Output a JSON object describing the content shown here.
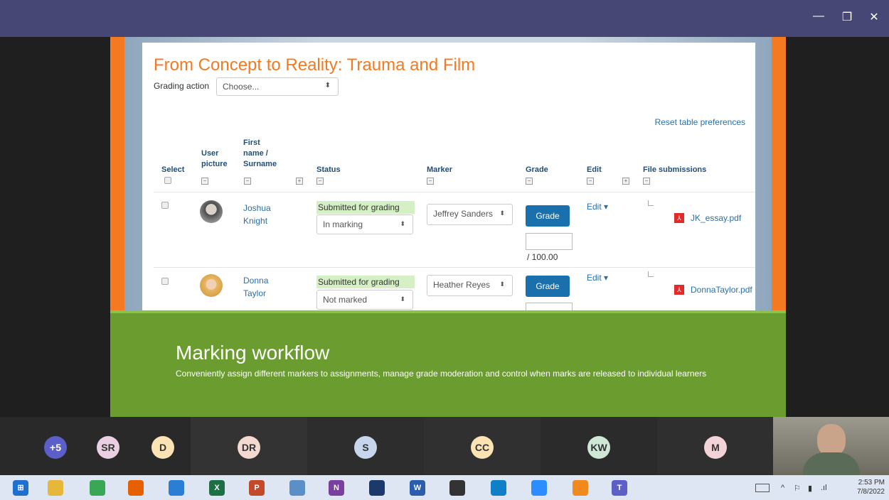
{
  "window": {
    "minimize": "—",
    "restore": "❐",
    "close": "✕"
  },
  "moodle": {
    "title": "From Concept to Reality: Trauma and Film",
    "grading_action_label": "Grading action",
    "grading_action_value": "Choose...",
    "reset_link": "Reset table preferences",
    "headers": {
      "select": "Select",
      "user_picture": [
        "User",
        "picture"
      ],
      "name": [
        "First",
        "name /",
        "Surname"
      ],
      "status": "Status",
      "marker": "Marker",
      "grade": "Grade",
      "edit": "Edit",
      "file_submissions": "File submissions"
    },
    "rows": [
      {
        "first": "Joshua",
        "last": "Knight",
        "status_badge": "Submitted for grading",
        "workflow": "In marking",
        "marker": "Jeffrey Sanders",
        "grade_button": "Grade",
        "grade_max": "/ 100.00",
        "edit": "Edit ▾",
        "file": "JK_essay.pdf"
      },
      {
        "first": "Donna",
        "last": "Taylor",
        "status_badge": "Submitted for grading",
        "workflow": "Not marked",
        "marker": "Heather Reyes",
        "grade_button": "Grade",
        "edit": "Edit ▾",
        "file": "DonnaTaylor.pdf"
      }
    ]
  },
  "banner": {
    "title": "Marking workflow",
    "subtitle": "Conveniently assign different markers to assignments, manage grade moderation and control when marks are released to individual learners"
  },
  "participants": [
    {
      "initials": "+5",
      "color": "#5b5fc7",
      "text_color": "#ffffff"
    },
    {
      "initials": "SR",
      "color": "#e9cfe1",
      "text_color": "#333333"
    },
    {
      "initials": "D",
      "color": "#fbe3b3",
      "text_color": "#333333"
    },
    {
      "initials": "DR",
      "color": "#f3d9d0",
      "text_color": "#333333"
    },
    {
      "initials": "S",
      "color": "#c7d6ec",
      "text_color": "#333333"
    },
    {
      "initials": "CC",
      "color": "#fbe3b3",
      "text_color": "#333333"
    },
    {
      "initials": "KW",
      "color": "#cfe8d6",
      "text_color": "#333333"
    },
    {
      "initials": "M",
      "color": "#f3d2d8",
      "text_color": "#333333"
    }
  ],
  "taskbar": {
    "apps": [
      {
        "name": "windows-start-icon",
        "label": "⊞",
        "color": "#1f6fd1"
      },
      {
        "name": "file-explorer-icon",
        "label": "",
        "color": "#e7b73a"
      },
      {
        "name": "chrome-icon",
        "label": "",
        "color": "#3aa757"
      },
      {
        "name": "firefox-icon",
        "label": "",
        "color": "#e66000"
      },
      {
        "name": "media-player-icon",
        "label": "",
        "color": "#2a7fd4"
      },
      {
        "name": "excel-icon",
        "label": "X",
        "color": "#1d7044"
      },
      {
        "name": "powerpoint-icon",
        "label": "P",
        "color": "#c4482a"
      },
      {
        "name": "notes-icon",
        "label": "",
        "color": "#5a8fc7"
      },
      {
        "name": "onenote-icon",
        "label": "N",
        "color": "#7b3fa0"
      },
      {
        "name": "vpn-icon",
        "label": "",
        "color": "#1b3a6b"
      },
      {
        "name": "word-icon",
        "label": "W",
        "color": "#2b5cad"
      },
      {
        "name": "inkscape-icon",
        "label": "",
        "color": "#333333"
      },
      {
        "name": "edge-icon",
        "label": "",
        "color": "#0f7fc8"
      },
      {
        "name": "zoom-icon",
        "label": "",
        "color": "#2d8cff"
      },
      {
        "name": "pdf-app-icon",
        "label": "",
        "color": "#f08a1c"
      },
      {
        "name": "teams-icon",
        "label": "T",
        "color": "#5b5fc7"
      }
    ],
    "tray_chevron": "^",
    "time": "2:53 PM",
    "date": "7/8/2022"
  }
}
